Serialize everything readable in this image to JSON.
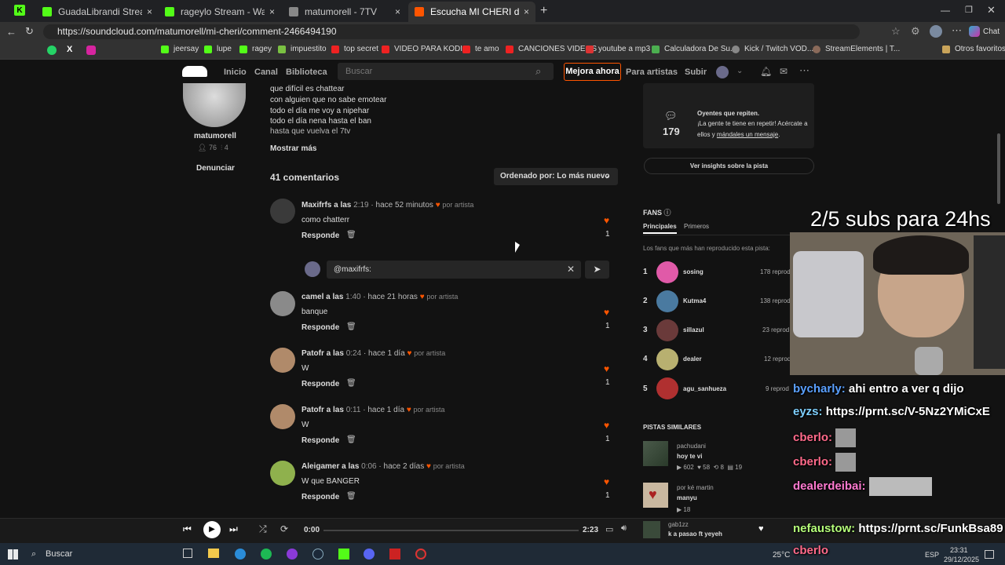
{
  "browser": {
    "tabs": [
      {
        "title": "GuadaLibrandi Stream - Watc",
        "color": "#53fc18"
      },
      {
        "title": "rageylo Stream - Watch Live on Ki",
        "color": "#53fc18"
      },
      {
        "title": "matumorell - 7TV",
        "color": "#2b2b2b"
      },
      {
        "title": "Escucha MI CHERI de matumorell",
        "color": "#f50"
      }
    ],
    "url": "https://soundcloud.com/matumorell/mi-cheri/comment-2466494190",
    "chat_label": "Chat",
    "bookmarks": [
      "jeersay",
      "lupe",
      "ragey",
      "impuestito",
      "top secret",
      "VIDEO PARA KODI...",
      "te amo",
      "CANCIONES VIDEOS",
      "youtube a mp3",
      "Calculadora De Su...",
      "Kick / Twitch VOD...",
      "StreamElements | T...",
      "Otros favoritos"
    ]
  },
  "header": {
    "nav": [
      "Inicio",
      "Canal",
      "Biblioteca"
    ],
    "search_placeholder": "Buscar",
    "upgrade": "Mejora ahora",
    "for_artists": "Para artistas",
    "upload": "Subir"
  },
  "artist": {
    "name": "matumorell",
    "followers": "76",
    "tracks": "4",
    "report": "Denunciar"
  },
  "lyrics": [
    "que difícil es chattear",
    "con alguien que no sabe emotear",
    "todo el día me voy a nipehar",
    "todo el día nena hasta el ban",
    "hasta que vuelva el 7tv"
  ],
  "show_more": "Mostrar más",
  "comments": {
    "count_label": "41 comentarios",
    "sort_label": "Ordenado por: Lo más nuevo",
    "reply_label": "Responde",
    "by_artist": "por artista",
    "reply_input_value": "@maxifrfs:",
    "items": [
      {
        "user": "Maxifrfs a las",
        "time": "2:19",
        "ago": "· hace 52 minutos",
        "text": "como chatterr",
        "likes": "1",
        "avatar": "#444"
      },
      {
        "user": "camel a las",
        "time": "1:40",
        "ago": "· hace 21 horas",
        "text": "banque",
        "likes": "1",
        "avatar": "#9a9a9a"
      },
      {
        "user": "Patofr a las",
        "time": "0:24",
        "ago": "· hace 1 día",
        "text": "W",
        "likes": "1",
        "avatar": "#c9a27a"
      },
      {
        "user": "Patofr a las",
        "time": "0:11",
        "ago": "· hace 1 día",
        "text": "W",
        "likes": "1",
        "avatar": "#c9a27a"
      },
      {
        "user": "Aleigamer a las",
        "time": "0:06",
        "ago": "· hace 2 días",
        "text": "W que BANGER",
        "likes": "1",
        "avatar": "#8fb14d"
      }
    ]
  },
  "sidebar": {
    "repeat_count": "179",
    "repeat_title": "Oyentes que repiten.",
    "repeat_text1": "¡La gente te tiene en repetir! Acércate a",
    "repeat_text2": "ellos y",
    "repeat_link": "mándales un mensaje",
    "insights": "Ver insights sobre la pista",
    "fans_title": "FANS",
    "fans_tabs": [
      "Principales",
      "Primeros"
    ],
    "fans_desc": "Los fans que más han reproducido esta pista:",
    "fans": [
      {
        "rank": "1",
        "name": "sosing",
        "plays": "178 reprod",
        "color": "#e05aa8"
      },
      {
        "rank": "2",
        "name": "Kutma4",
        "plays": "138 reprod",
        "color": "#4a7aa0"
      },
      {
        "rank": "3",
        "name": "sillazul",
        "plays": "23 reprod",
        "color": "#6a3a3a"
      },
      {
        "rank": "4",
        "name": "dealer",
        "plays": "12 reprod",
        "color": "#b8b070"
      },
      {
        "rank": "5",
        "name": "agu_sanhueza",
        "plays": "9 reprod",
        "color": "#b03030"
      }
    ],
    "similar_title": "PISTAS SIMILARES",
    "similar": [
      {
        "artist": "pachudani",
        "title": "hoy te vi",
        "plays": "602",
        "likes": "58",
        "reposts": "8",
        "comments": "19"
      },
      {
        "artist": "por ké martin",
        "title": "manyu",
        "plays": "18"
      }
    ]
  },
  "player": {
    "current": "0:00",
    "duration": "2:23",
    "now_artist": "gab1zz",
    "now_title": "k a pasao ft yeyeh"
  },
  "taskbar": {
    "search": "Buscar",
    "temp": "25°C",
    "lang": "ESP",
    "time": "23:31",
    "date": "29/12/2025"
  },
  "overlay": {
    "subs": "2/5 subs para 24hs",
    "chat": [
      {
        "user": "bycharly:",
        "msg": "ahi entro a ver q dijo",
        "color": "#5aa0ff"
      },
      {
        "user": "eyzs:",
        "msg": "https://prnt.sc/V-5Nz2YMiCxE",
        "color": "#7fd0ff"
      },
      {
        "user": "cberlo:",
        "msg": "",
        "color": "#ff6a8a"
      },
      {
        "user": "cberlo:",
        "msg": "",
        "color": "#ff6a8a"
      },
      {
        "user": "dealerdeibai:",
        "msg": "",
        "color": "#ff7ad0"
      },
      {
        "user": "nefaustow:",
        "msg": "https://prnt.sc/FunkBsa89",
        "color": "#b5ff7a"
      },
      {
        "user": "cberlo",
        "msg": "",
        "color": "#ff6a8a"
      }
    ]
  }
}
